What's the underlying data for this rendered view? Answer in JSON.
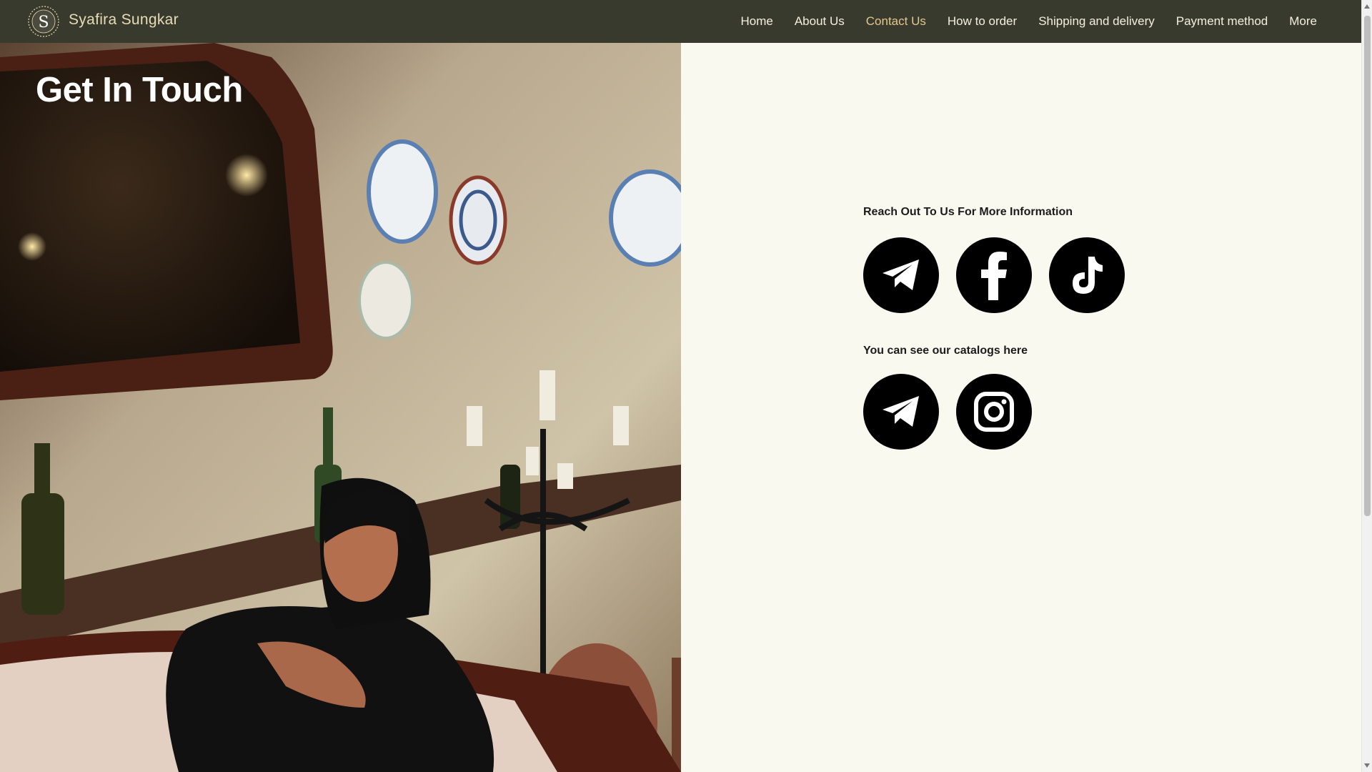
{
  "header": {
    "brand_name": "Syafira Sungkar",
    "logo_letter": "S",
    "nav": [
      {
        "label": "Home"
      },
      {
        "label": "About Us"
      },
      {
        "label": "Contact Us",
        "active": true
      },
      {
        "label": "How to order"
      },
      {
        "label": "Shipping and delivery"
      },
      {
        "label": "Payment method"
      },
      {
        "label": "More"
      }
    ]
  },
  "hero": {
    "title": "Get In Touch"
  },
  "contact": {
    "reach_label": "Reach Out To Us For More Information",
    "reach_icons": [
      "telegram-icon",
      "facebook-icon",
      "tiktok-icon"
    ],
    "catalog_label": "You can see our catalogs here",
    "catalog_icons": [
      "telegram-icon",
      "instagram-icon"
    ]
  },
  "colors": {
    "header_bg": "#393a2e",
    "brand_text": "#e8dcb5",
    "active_nav": "#e2c88c",
    "page_bg": "#f9f9ef",
    "icon_bg": "#000000"
  }
}
